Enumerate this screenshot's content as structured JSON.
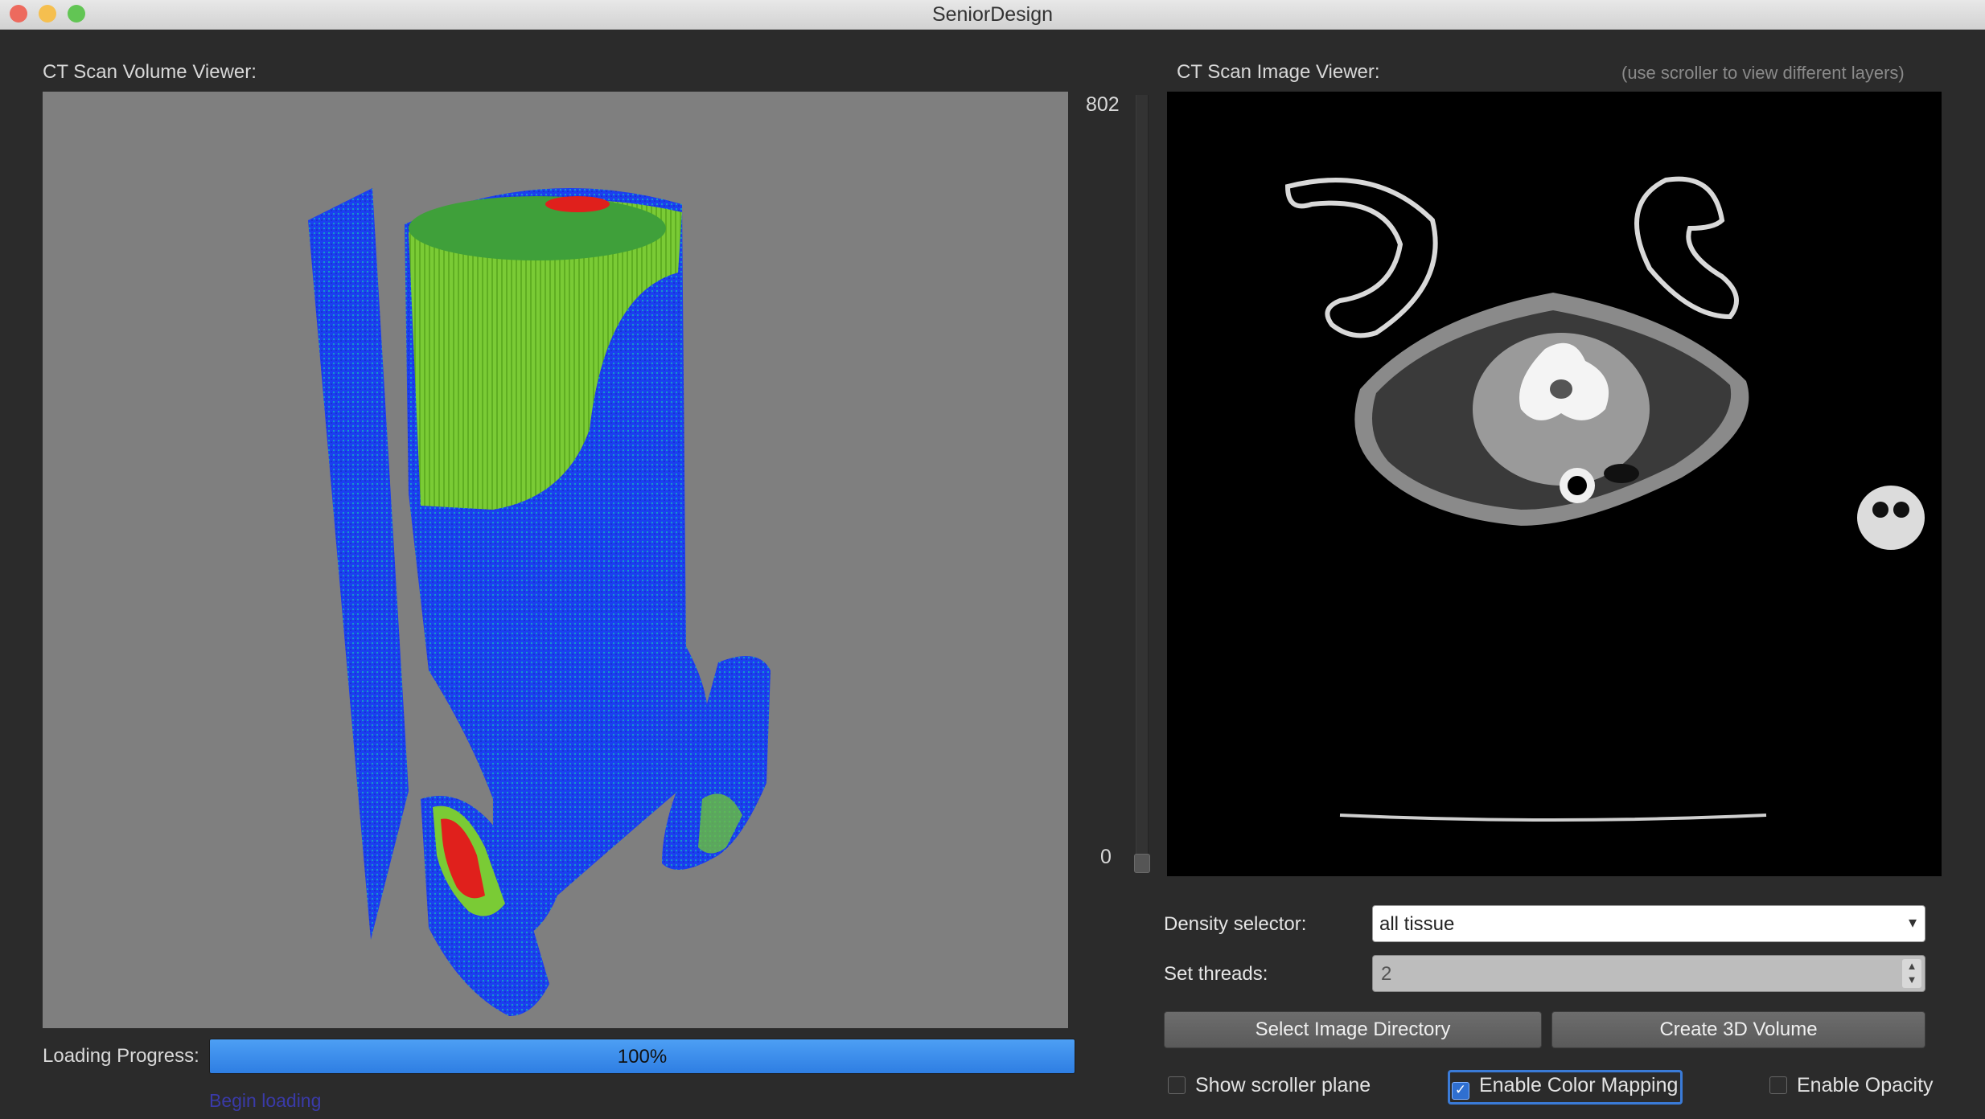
{
  "window": {
    "title": "SeniorDesign",
    "traffic_lights": [
      "#ed6a5e",
      "#f5bf4f",
      "#62c554"
    ]
  },
  "volume_viewer": {
    "label": "CT Scan Volume Viewer:",
    "background": "#7f7f7f",
    "render_colors": [
      "#1a3cf0",
      "#7fd13b",
      "#e0201c"
    ]
  },
  "image_viewer": {
    "label": "CT Scan Image Viewer:",
    "hint": "(use scroller to view different layers)"
  },
  "layer_slider": {
    "max_label": "802",
    "min_label": "0",
    "value": 0
  },
  "loading": {
    "label": "Loading Progress:",
    "progress_text": "100%",
    "progress_fraction": 1.0,
    "begin_link": "Begin loading"
  },
  "controls": {
    "density_label": "Density selector:",
    "density_value": "all tissue",
    "threads_label": "Set threads:",
    "threads_value": "2",
    "select_dir_button": "Select Image Directory",
    "create_volume_button": "Create 3D Volume",
    "show_scroller_plane": {
      "label": "Show scroller plane",
      "checked": false
    },
    "enable_color_mapping": {
      "label": "Enable Color Mapping",
      "checked": true
    },
    "enable_opacity": {
      "label": "Enable Opacity",
      "checked": false
    }
  }
}
